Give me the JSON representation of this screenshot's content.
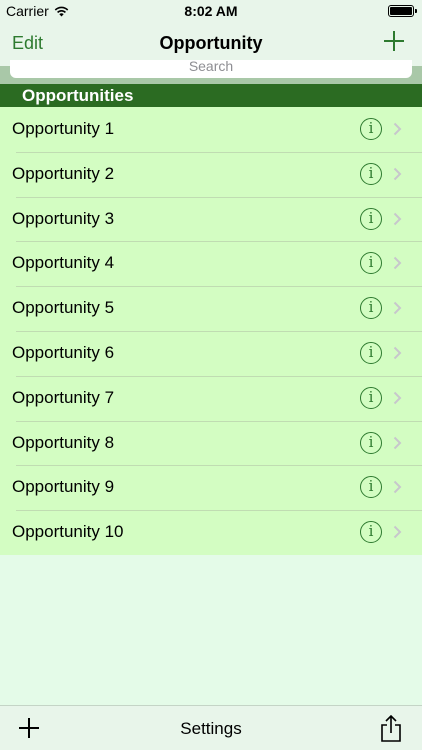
{
  "status_bar": {
    "carrier": "Carrier",
    "time": "8:02 AM",
    "battery_level": 1.0
  },
  "nav_bar": {
    "edit_label": "Edit",
    "title": "Opportunity",
    "add_icon": "plus-icon"
  },
  "search": {
    "placeholder": "Search"
  },
  "section": {
    "title": "Opportunities"
  },
  "rows": [
    {
      "label": "Opportunity 1"
    },
    {
      "label": "Opportunity 2"
    },
    {
      "label": "Opportunity 3"
    },
    {
      "label": "Opportunity 4"
    },
    {
      "label": "Opportunity 5"
    },
    {
      "label": "Opportunity 6"
    },
    {
      "label": "Opportunity 7"
    },
    {
      "label": "Opportunity 8"
    },
    {
      "label": "Opportunity 9"
    },
    {
      "label": "Opportunity 10"
    }
  ],
  "toolbar": {
    "settings_label": "Settings",
    "add_icon": "plus-icon",
    "share_icon": "share-icon"
  },
  "colors": {
    "accent": "#2d7a2f",
    "section_header": "#2b6b22",
    "row_background": "#d3fdc2",
    "page_background": "#e4fbe8"
  }
}
